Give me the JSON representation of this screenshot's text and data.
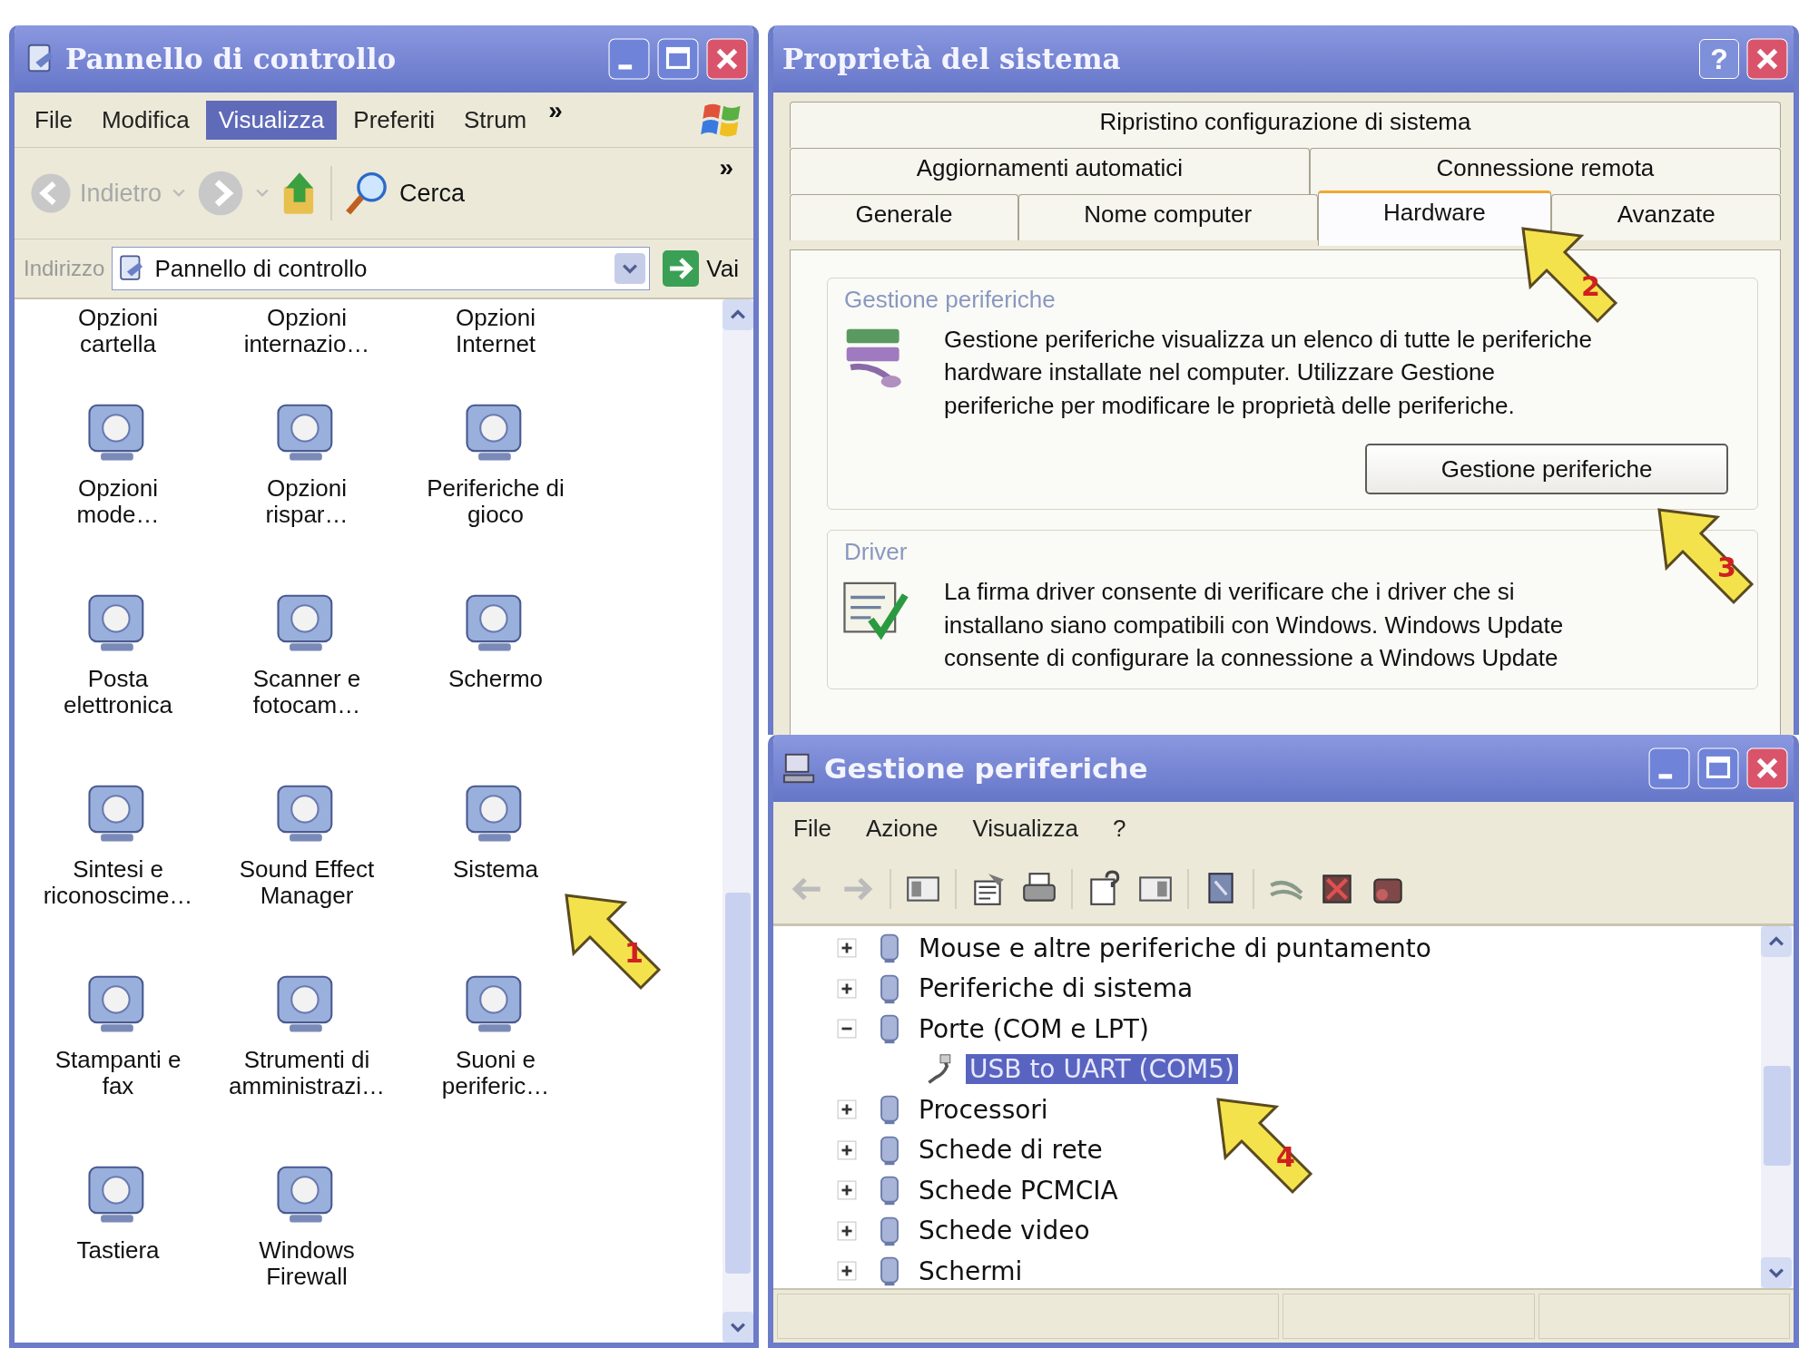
{
  "control_panel": {
    "title": "Pannello di controllo",
    "menu": [
      {
        "label": "File",
        "selected": false
      },
      {
        "label": "Modifica",
        "selected": false
      },
      {
        "label": "Visualizza",
        "selected": true
      },
      {
        "label": "Preferiti",
        "selected": false
      },
      {
        "label": "Strum",
        "selected": false
      }
    ],
    "menu_more": "»",
    "toolbar": {
      "back": "Indietro",
      "search": "Cerca",
      "more": "»"
    },
    "address": {
      "label": "Indirizzo",
      "value": "Pannello di controllo",
      "go": "Vai"
    },
    "top_row_labels": [
      "Opzioni\ncartella",
      "Opzioni\ninternazio…",
      "Opzioni\nInternet"
    ],
    "items": [
      {
        "label": "Opzioni\nmode…"
      },
      {
        "label": "Opzioni\nrispar…"
      },
      {
        "label": "Periferiche di\ngioco"
      },
      {
        "label": "Posta\nelettronica"
      },
      {
        "label": "Scanner e\nfotocam…"
      },
      {
        "label": "Schermo"
      },
      {
        "label": "Sintesi e\nriconoscime…"
      },
      {
        "label": "Sound Effect\nManager"
      },
      {
        "label": "Sistema"
      },
      {
        "label": "Stampanti e\nfax"
      },
      {
        "label": "Strumenti di\namministrazi…"
      },
      {
        "label": "Suoni e\nperiferic…"
      },
      {
        "label": "Tastiera"
      },
      {
        "label": "Windows\nFirewall"
      }
    ]
  },
  "system_properties": {
    "title": "Proprietà del sistema",
    "help": "?",
    "tab_rows": [
      [
        {
          "label": "Ripristino configurazione di sistema",
          "selected": false
        }
      ],
      [
        {
          "label": "Aggiornamenti automatici",
          "selected": false
        },
        {
          "label": "Connessione remota",
          "selected": false
        }
      ],
      [
        {
          "label": "Generale",
          "selected": false
        },
        {
          "label": "Nome computer",
          "selected": false
        },
        {
          "label": "Hardware",
          "selected": true
        },
        {
          "label": "Avanzate",
          "selected": false
        }
      ]
    ],
    "groups": [
      {
        "title": "Gestione periferiche",
        "text": "Gestione periferiche visualizza un elenco di tutte le periferiche\nhardware installate nel computer. Utilizzare Gestione\nperiferiche per modificare le proprietà delle periferiche.",
        "button": "Gestione periferiche"
      },
      {
        "title": "Driver",
        "text": "La firma driver consente di verificare che i driver che si\ninstallano siano compatibili con Windows. Windows Update\nconsente di configurare la connessione a Windows Update"
      }
    ]
  },
  "device_manager": {
    "title": "Gestione periferiche",
    "menu": [
      "File",
      "Azione",
      "Visualizza",
      "?"
    ],
    "tree": [
      {
        "label": "Mouse e altre periferiche di puntamento",
        "expanded": false
      },
      {
        "label": "Periferiche di sistema",
        "expanded": false
      },
      {
        "label": "Porte (COM e LPT)",
        "expanded": true,
        "children": [
          {
            "label": "USB to UART (COM5)",
            "selected": true
          }
        ]
      },
      {
        "label": "Processori",
        "expanded": false
      },
      {
        "label": "Schede di rete",
        "expanded": false
      },
      {
        "label": "Schede PCMCIA",
        "expanded": false
      },
      {
        "label": "Schede video",
        "expanded": false
      },
      {
        "label": "Schermi",
        "expanded": false
      }
    ]
  },
  "callouts": [
    {
      "number": "1"
    },
    {
      "number": "2"
    },
    {
      "number": "3"
    },
    {
      "number": "4"
    }
  ]
}
